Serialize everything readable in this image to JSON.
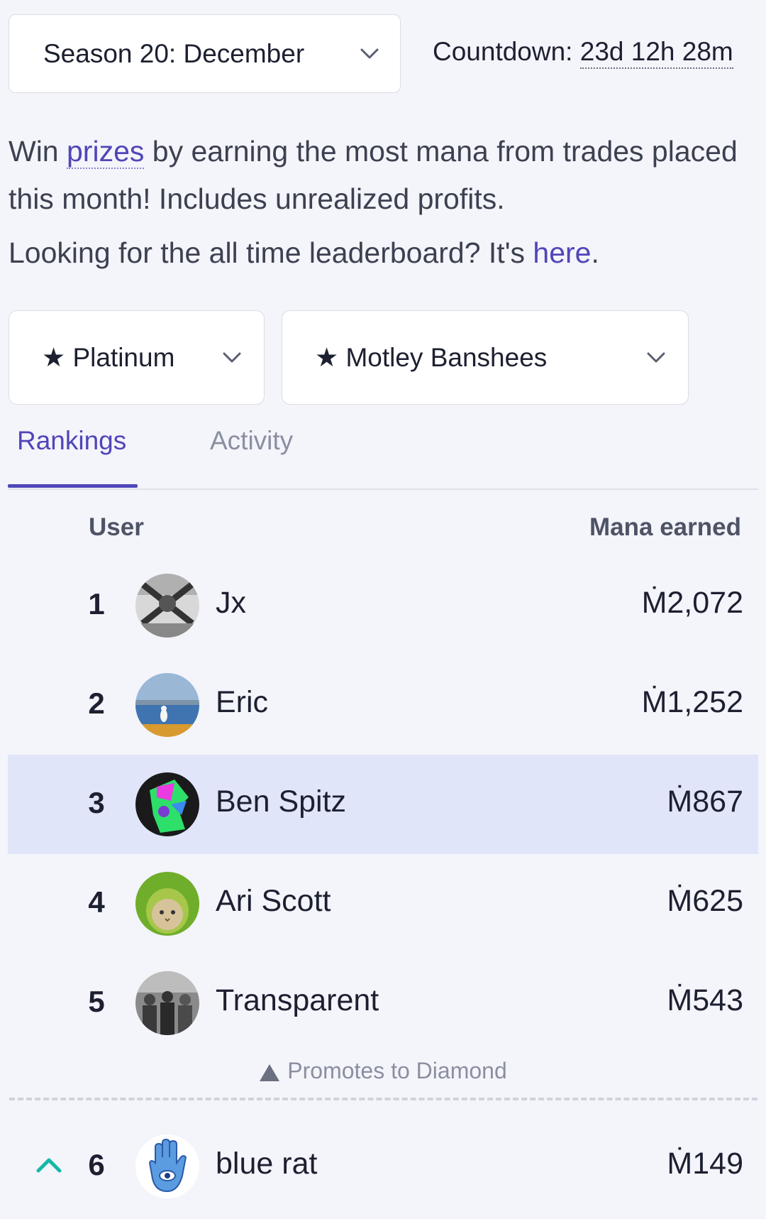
{
  "season": {
    "label": "Season 20: December"
  },
  "countdown": {
    "label": "Countdown:",
    "value": "23d 12h 28m"
  },
  "description": {
    "part1": "Win ",
    "prizes_link": "prizes",
    "part2": " by earning the most mana from trades placed this month! Includes unrealized profits.",
    "alltime_part1": "Looking for the all time leaderboard? It's ",
    "here_link": "here",
    "alltime_part2": "."
  },
  "filters": {
    "league": "★ Platinum",
    "division": "★ Motley Banshees"
  },
  "tabs": [
    {
      "label": "Rankings",
      "active": true
    },
    {
      "label": "Activity",
      "active": false
    }
  ],
  "table": {
    "headers": {
      "user": "User",
      "mana": "Mana earned"
    },
    "rows": [
      {
        "rank": "1",
        "name": "Jx",
        "mana": "Ṁ2,072",
        "avatar": "jx-avatar"
      },
      {
        "rank": "2",
        "name": "Eric",
        "mana": "Ṁ1,252",
        "avatar": "seagull-avatar"
      },
      {
        "rank": "3",
        "name": "Ben Spitz",
        "mana": "Ṁ867",
        "avatar": "colorful-avatar",
        "highlighted": true
      },
      {
        "rank": "4",
        "name": "Ari Scott",
        "mana": "Ṁ625",
        "avatar": "cat-avatar"
      },
      {
        "rank": "5",
        "name": "Transparent",
        "mana": "Ṁ543",
        "avatar": "group-photo-avatar"
      },
      {
        "rank": "6",
        "name": "blue rat",
        "mana": "Ṁ149",
        "avatar": "hamsa-avatar"
      }
    ],
    "promotion_note": "Promotes to Diamond"
  },
  "colors": {
    "accent": "#5046b8",
    "highlight_row": "#e0e5f9",
    "promote_up": "#14b8a6"
  }
}
